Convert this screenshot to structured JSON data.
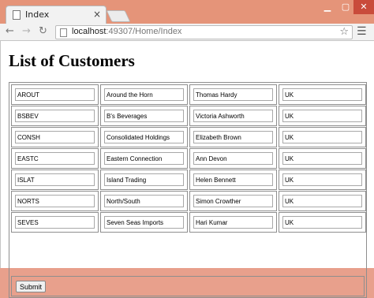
{
  "browser": {
    "tab_title": "Index",
    "tab_close": "×",
    "url_host": "localhost",
    "url_rest": ":49307/Home/Index",
    "window_buttons": {
      "minimize": "▁",
      "maximize": "▢",
      "close": "✕"
    }
  },
  "page": {
    "heading": "List of Customers",
    "rows": [
      [
        "AROUT",
        "Around the Horn",
        "Thomas Hardy",
        "UK"
      ],
      [
        "BSBEV",
        "B's Beverages",
        "Victoria Ashworth",
        "UK"
      ],
      [
        "CONSH",
        "Consolidated Holdings",
        "Elizabeth Brown",
        "UK"
      ],
      [
        "EASTC",
        "Eastern Connection",
        "Ann Devon",
        "UK"
      ],
      [
        "ISLAT",
        "Island Trading",
        "Helen Bennett",
        "UK"
      ],
      [
        "NORTS",
        "North/South",
        "Simon Crowther",
        "UK"
      ],
      [
        "SEVES",
        "Seven Seas Imports",
        "Hari Kumar",
        "UK"
      ]
    ],
    "submit_label": "Submit"
  },
  "icons": {
    "back": "arrow-left-icon",
    "forward": "arrow-right-icon",
    "reload": "reload-icon",
    "star": "star-icon",
    "menu": "hamburger-menu-icon"
  }
}
